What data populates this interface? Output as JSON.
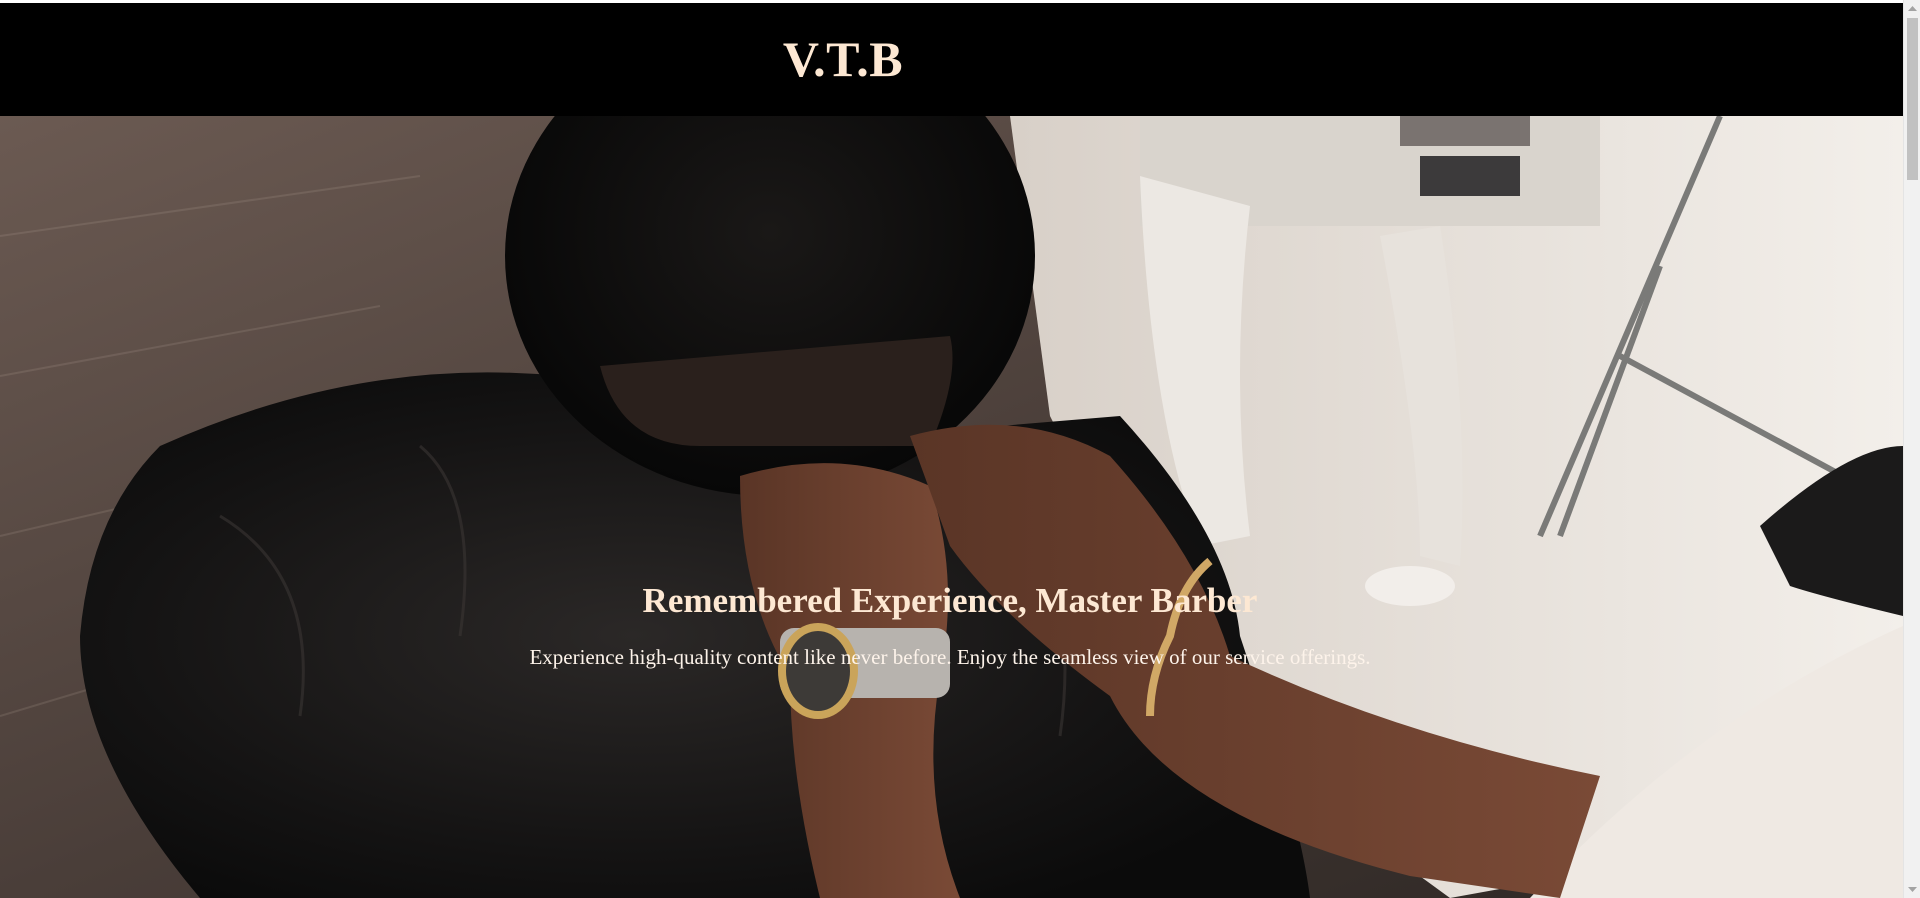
{
  "header": {
    "brand": "V.T.B"
  },
  "hero": {
    "title": "Remembered Experience, Master Barber",
    "subtitle": "Experience high-quality content like never before. Enjoy the seamless view of our service offerings.",
    "image_description_icon": "barber-photo"
  },
  "colors": {
    "header_bg": "#000000",
    "brand_text": "#fde8d3",
    "hero_text": "#fde8d3"
  },
  "scrollbar": {
    "up_icon": "chevron-up-icon",
    "down_icon": "chevron-down-icon"
  }
}
